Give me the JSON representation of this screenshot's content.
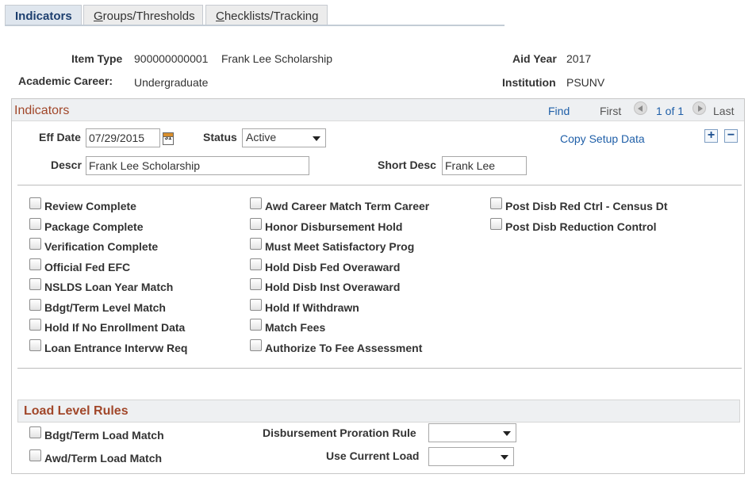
{
  "tabs": [
    {
      "label": "Indicators",
      "active": true
    },
    {
      "label": "Groups/Thresholds",
      "underline": "G",
      "rest": "roups/Thresholds"
    },
    {
      "label": "Checklists/Tracking",
      "underline": "C",
      "rest": "hecklists/Tracking"
    }
  ],
  "header": {
    "item_type_label": "Item Type",
    "item_type_code": "900000000001",
    "item_type_desc": "Frank Lee Scholarship",
    "aid_year_label": "Aid Year",
    "aid_year_value": "2017",
    "academic_career_label": "Academic Career:",
    "academic_career_value": "Undergraduate",
    "institution_label": "Institution",
    "institution_value": "PSUNV"
  },
  "indicators": {
    "title": "Indicators",
    "find": "Find",
    "first": "First",
    "count": "1 of 1",
    "last": "Last",
    "eff_date_label": "Eff Date",
    "eff_date_value": "07/29/2015",
    "calendar_text": "31",
    "status_label": "Status",
    "status_value": "Active",
    "copy_setup": "Copy Setup Data",
    "add_symbol": "+",
    "remove_symbol": "−",
    "descr_label": "Descr",
    "descr_value": "Frank Lee Scholarship",
    "short_desc_label": "Short Desc",
    "short_desc_value": "Frank Lee",
    "col1": [
      "Review Complete",
      "Package Complete",
      "Verification Complete",
      "Official Fed EFC",
      "NSLDS Loan Year Match",
      "Bdgt/Term Level Match",
      "Hold If No Enrollment Data",
      "Loan Entrance Intervw Req"
    ],
    "col2": [
      "Awd Career Match Term Career",
      "Honor Disbursement Hold",
      "Must Meet Satisfactory Prog",
      "Hold Disb Fed Overaward",
      "Hold Disb Inst Overaward",
      "Hold If Withdrawn",
      "Match Fees",
      "Authorize To Fee Assessment"
    ],
    "col3": [
      "Post Disb Red Ctrl - Census Dt",
      "Post Disb Reduction Control"
    ]
  },
  "load_level": {
    "title": "Load Level Rules",
    "bdgt_label": "Bdgt/Term Load Match",
    "awd_label": "Awd/Term Load Match",
    "proration_label": "Disbursement Proration Rule",
    "proration_value": "",
    "current_load_label": "Use Current Load",
    "current_load_value": ""
  },
  "colors": {
    "accent": "#a1472a",
    "link": "#1f5fa8",
    "tab_active": "#1d3f6f"
  }
}
